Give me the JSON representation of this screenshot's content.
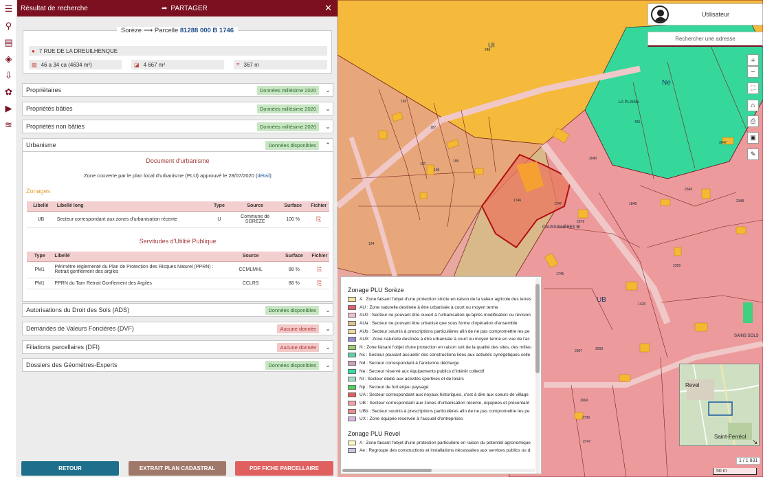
{
  "panel": {
    "title": "Résultat de recherche",
    "share_label": "PARTAGER",
    "close_glyph": "✕"
  },
  "parcel": {
    "commune_prefix": "Sorèze ⟶ Parcelle",
    "reference": "81288 000 B 1746",
    "address": "7 RUE DE LA DREUILHENQUE",
    "cadastral_area": "46 a 34 ca (4634 m²)",
    "measured_area": "4 667 m²",
    "perimeter": "367 m"
  },
  "sections": [
    {
      "label": "Propriétaires",
      "badge": "Données millésime 2020",
      "status": "green",
      "chevron": "⌄"
    },
    {
      "label": "Propriétés bâties",
      "badge": "Données millésime 2020",
      "status": "green",
      "chevron": "⌄"
    },
    {
      "label": "Propriétés non bâties",
      "badge": "Données millésime 2020",
      "status": "green",
      "chevron": "⌄"
    },
    {
      "label": "Urbanisme",
      "badge": "Données disponibles",
      "status": "green",
      "chevron": "⌃"
    },
    {
      "label": "Autorisations du Droit des Sols (ADS)",
      "badge": "Données disponibles",
      "status": "green",
      "chevron": "⌄"
    },
    {
      "label": "Demandes de Valeurs Foncières (DVF)",
      "badge": "Aucune donnée",
      "status": "red",
      "chevron": "⌄"
    },
    {
      "label": "Filiations parcellaires (DFI)",
      "badge": "Aucune donnée",
      "status": "red",
      "chevron": "⌄"
    },
    {
      "label": "Dossiers des Géomètres-Experts",
      "badge": "Données disponibles",
      "status": "green",
      "chevron": "⌄"
    }
  ],
  "urbanisme": {
    "doc_title": "Document d'urbanisme",
    "doc_text": "Zone couverte par le plan local d'urbanisme (PLU) approuvé le 28/07/2020 (",
    "doc_link": "détail",
    "doc_text_end": ")",
    "zonages_title": "Zonages",
    "zonages_headers": [
      "Libellé",
      "Libellé long",
      "Type",
      "Source",
      "Surface",
      "Fichier"
    ],
    "zonages_rows": [
      {
        "libelle": "UB",
        "libelle_long": "Secteur correspondant aux zones d'urbanisation récente",
        "type": "U",
        "source": "Commune de SOREZE",
        "surface": "100 %"
      }
    ],
    "sup_title": "Servitudes d'Utilité Publique",
    "sup_headers": [
      "Type",
      "Libellé",
      "Source",
      "Surface",
      "Fichier"
    ],
    "sup_rows": [
      {
        "type": "PM1",
        "libelle": "Périmètre réglementé du Plan de Protection des Risques Naturel (PPRN) : Retrait gonflement des argiles",
        "source": "CCMLMHL",
        "surface": "88 %"
      },
      {
        "type": "PM1",
        "libelle": "PPRN du Tarn Retrait Gonflement des Argiles",
        "source": "CCLRS",
        "surface": "88 %"
      }
    ]
  },
  "buttons": {
    "back": "RETOUR",
    "extract": "EXTRAIT PLAN CADASTRAL",
    "pdf": "PDF FICHE PARCELLAIRE"
  },
  "colors": {
    "brand": "#7a1020",
    "back_button": "#1e6f8c",
    "extract_button": "#a0786a",
    "pdf_button": "#e06060"
  },
  "map": {
    "user_label": "Utilisateur",
    "search_placeholder": "Rechercher une adresse",
    "zone_ui": "UI",
    "zone_ne": "Ne",
    "zone_ub": "UB",
    "place_la_plaine": "LA PLAINE",
    "place_caussegneres": "CAUSSIGNÈRES BI",
    "place_saint_sols": "SAINS SOLS",
    "overview_revel": "Revel",
    "overview_saint_ferreol": "Saint-Ferréol",
    "overview_ratio": "1 / 1 831",
    "scale": "50 m",
    "parcel_numbers": [
      "240",
      "165",
      "187",
      "197",
      "195",
      "124",
      "199",
      "189",
      "260",
      "186",
      "285",
      "143",
      "1746",
      "1747",
      "1848",
      "2345",
      "2379",
      "2395",
      "2348",
      "3047",
      "420",
      "425",
      "2040",
      "2003",
      "2007",
      "2669",
      "1426",
      "2736",
      "2747",
      "1745"
    ]
  },
  "legend": {
    "soreze_title": "Zonage PLU Sorèze",
    "soreze_items": [
      {
        "text": "A : Zone faisant l'objet d'une protection stricte en raison de la valeur agricole des terres",
        "color": "#f0e6a0"
      },
      {
        "text": "AU : Zone naturelle destinée à être urbanisée à court ou moyen terme",
        "color": "#e06070"
      },
      {
        "text": "AU0 : Secteur ne pouvant être ouvert à l'urbanisation qu'après modification ou révision",
        "color": "#f2c0c8"
      },
      {
        "text": "AUa : Secteur ne pouvant être urbanisé que sous forme d'opération d'ensemble",
        "color": "#e0c090"
      },
      {
        "text": "AUb : Secteur soumis à prescriptions particulières afin de ne pas compromettre les pe",
        "color": "#f0d8a0"
      },
      {
        "text": "AUX : Zone naturelle destinée à être urbanisée à court ou moyen terme en vue de l'ac",
        "color": "#9a8ad0"
      },
      {
        "text": "N : Zone faisant l'objet d'une protection en raison soit de la qualité des sites, des milieu",
        "color": "#9ad070"
      },
      {
        "text": "Nc : Secteur pouvant accueillir des constructions liées aux activités cynégétiques colle",
        "color": "#60d0a0"
      },
      {
        "text": "Nd : Secteur correspondant à l'ancienne décharge",
        "color": "#d0a0c0"
      },
      {
        "text": "Ne : Secteur réservé aux équipements publics d'intérêt collectif",
        "color": "#30e0a0"
      },
      {
        "text": "Nl : Secteur dédié aux activités sportives et de loisirs",
        "color": "#a0e0c0"
      },
      {
        "text": "Np : Secteur de fort enjeu paysagé",
        "color": "#50d060"
      },
      {
        "text": "UA : Secteur correspondant aux noyaux historiques, c'est à dire aux coeurs de village",
        "color": "#e06060"
      },
      {
        "text": "UB : Secteur correspondant aux zones d'urbanisation récente, équipées et présentant",
        "color": "#f0a0a8"
      },
      {
        "text": "UBb : Secteur soumis à prescriptions particulières afin de ne pas compromettre les pe",
        "color": "#e89088"
      },
      {
        "text": "UX : Zone équipée réservée à l'accueil d'entreprises",
        "color": "#d8b8e0"
      }
    ],
    "revel_title": "Zonage PLU Revel",
    "revel_items": [
      {
        "text": "A : Zone faisant l'objet d'une protection particulière en raison du potentiel agronomique",
        "color": "#fff8c0"
      },
      {
        "text": "Ae : Regroupe des constructions et installations nécessaires aux services publics ou d",
        "color": "#c8c8e8"
      }
    ]
  }
}
